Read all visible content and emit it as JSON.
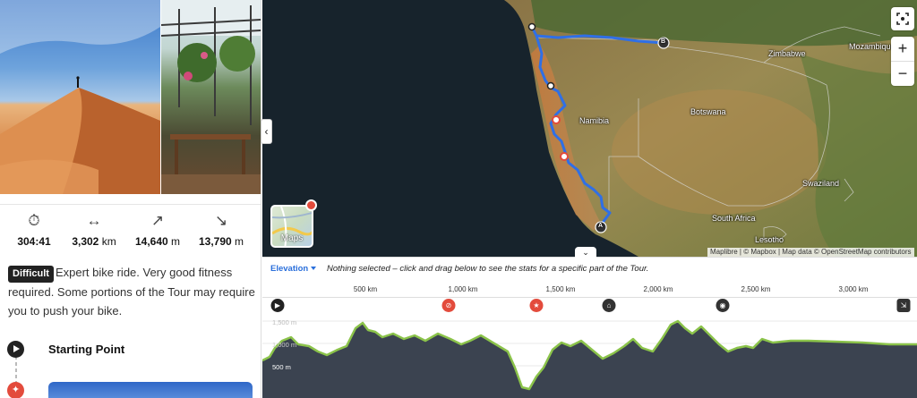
{
  "stats": [
    {
      "icon": "stopwatch-icon",
      "glyph": "⏱",
      "value": "304:41",
      "unit": ""
    },
    {
      "icon": "distance-icon",
      "glyph": "↔",
      "value": "3,302",
      "unit": "km"
    },
    {
      "icon": "uphill-icon",
      "glyph": "↗",
      "value": "14,640",
      "unit": "m"
    },
    {
      "icon": "downhill-icon",
      "glyph": "↘",
      "value": "13,790",
      "unit": "m"
    }
  ],
  "difficulty": {
    "badge": "Difficult",
    "text": "Expert bike ride. Very good fitness required. Some portions of the Tour may require you to push your bike."
  },
  "timeline": {
    "start_label": "Starting Point"
  },
  "map": {
    "labels": [
      "Namibia",
      "Botswana",
      "Zimbabwe",
      "Mozambique",
      "South Africa",
      "Swaziland",
      "Lesotho"
    ],
    "start_marker": "A",
    "end_marker": "B",
    "maps_button": "Maps",
    "attribution": "Maplibre | © Mapbox | Map data © OpenStreetMap contributors",
    "zoom_in": "+",
    "zoom_out": "−"
  },
  "elevation": {
    "tab_label": "Elevation",
    "message": "Nothing selected – click and drag below to see the stats for a specific part of the Tour.",
    "distance_ticks": [
      "500 km",
      "1,000 km",
      "1,500 km",
      "2,000 km",
      "2,500 km",
      "3,000 km"
    ],
    "y_labels": [
      "1,500 m",
      "1,000 m",
      "500 m"
    ]
  },
  "colors": {
    "route": "#2f6fe6",
    "profile_fill": "#3b4350",
    "profile_line": "#8bc34a",
    "badge": "#222222",
    "accent_red": "#e34b3c"
  }
}
